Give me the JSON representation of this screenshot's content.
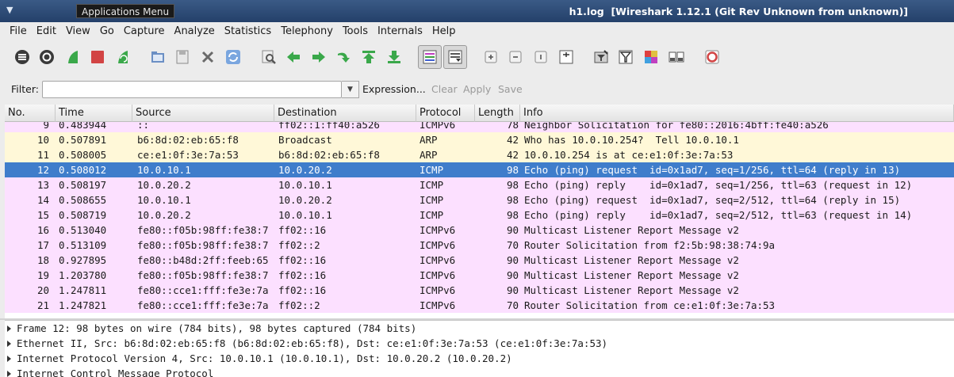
{
  "titlebar": {
    "app_menu": "Applications Menu",
    "title": "h1.log  [Wireshark 1.12.1 (Git Rev Unknown from unknown)]"
  },
  "menubar": [
    "File",
    "Edit",
    "View",
    "Go",
    "Capture",
    "Analyze",
    "Statistics",
    "Telephony",
    "Tools",
    "Internals",
    "Help"
  ],
  "toolbar": {
    "icons": [
      "interface-list-icon",
      "capture-options-icon",
      "start-capture-icon",
      "stop-capture-icon",
      "restart-capture-icon",
      "open-file-icon",
      "save-file-icon",
      "close-file-icon",
      "reload-icon",
      "find-packet-icon",
      "go-back-icon",
      "go-forward-icon",
      "go-to-packet-icon",
      "go-first-icon",
      "go-last-icon",
      "colorize-icon",
      "auto-scroll-icon",
      "zoom-in-icon",
      "zoom-out-icon",
      "normal-size-icon",
      "resize-columns-icon",
      "capture-filters-icon",
      "display-filters-icon",
      "coloring-rules-icon",
      "preferences-icon",
      "help-icon"
    ],
    "accent_green": "#3aa84a",
    "accent_red": "#d24444"
  },
  "filterbar": {
    "label": "Filter:",
    "value": "",
    "expression": "Expression...",
    "clear": "Clear",
    "apply": "Apply",
    "save": "Save"
  },
  "columns": [
    "No.",
    "Time",
    "Source",
    "Destination",
    "Protocol",
    "Length",
    "Info"
  ],
  "colors": {
    "icmpv6_bg": "#fce0ff",
    "arp_bg": "#fff8d8",
    "icmp_bg": "#fce0ff",
    "selected_bg": "#3f7dcb"
  },
  "packets": [
    {
      "no": "9",
      "time": "0.483944",
      "src": "::",
      "dst": "ff02::1:ff40:a526",
      "proto": "ICMPv6",
      "len": "78",
      "info": "Neighbor Solicitation for fe80::2016:4bff:fe40:a526",
      "kind": "icmpv6",
      "selected": false
    },
    {
      "no": "10",
      "time": "0.507891",
      "src": "b6:8d:02:eb:65:f8",
      "dst": "Broadcast",
      "proto": "ARP",
      "len": "42",
      "info": "Who has 10.0.10.254?  Tell 10.0.10.1",
      "kind": "arp",
      "selected": false
    },
    {
      "no": "11",
      "time": "0.508005",
      "src": "ce:e1:0f:3e:7a:53",
      "dst": "b6:8d:02:eb:65:f8",
      "proto": "ARP",
      "len": "42",
      "info": "10.0.10.254 is at ce:e1:0f:3e:7a:53",
      "kind": "arp",
      "selected": false
    },
    {
      "no": "12",
      "time": "0.508012",
      "src": "10.0.10.1",
      "dst": "10.0.20.2",
      "proto": "ICMP",
      "len": "98",
      "info": "Echo (ping) request  id=0x1ad7, seq=1/256, ttl=64 (reply in 13)",
      "kind": "icmp",
      "selected": true
    },
    {
      "no": "13",
      "time": "0.508197",
      "src": "10.0.20.2",
      "dst": "10.0.10.1",
      "proto": "ICMP",
      "len": "98",
      "info": "Echo (ping) reply    id=0x1ad7, seq=1/256, ttl=63 (request in 12)",
      "kind": "icmp",
      "selected": false
    },
    {
      "no": "14",
      "time": "0.508655",
      "src": "10.0.10.1",
      "dst": "10.0.20.2",
      "proto": "ICMP",
      "len": "98",
      "info": "Echo (ping) request  id=0x1ad7, seq=2/512, ttl=64 (reply in 15)",
      "kind": "icmp",
      "selected": false
    },
    {
      "no": "15",
      "time": "0.508719",
      "src": "10.0.20.2",
      "dst": "10.0.10.1",
      "proto": "ICMP",
      "len": "98",
      "info": "Echo (ping) reply    id=0x1ad7, seq=2/512, ttl=63 (request in 14)",
      "kind": "icmp",
      "selected": false
    },
    {
      "no": "16",
      "time": "0.513040",
      "src": "fe80::f05b:98ff:fe38:7",
      "dst": "ff02::16",
      "proto": "ICMPv6",
      "len": "90",
      "info": "Multicast Listener Report Message v2",
      "kind": "icmpv6",
      "selected": false
    },
    {
      "no": "17",
      "time": "0.513109",
      "src": "fe80::f05b:98ff:fe38:7",
      "dst": "ff02::2",
      "proto": "ICMPv6",
      "len": "70",
      "info": "Router Solicitation from f2:5b:98:38:74:9a",
      "kind": "icmpv6",
      "selected": false
    },
    {
      "no": "18",
      "time": "0.927895",
      "src": "fe80::b48d:2ff:feeb:65",
      "dst": "ff02::16",
      "proto": "ICMPv6",
      "len": "90",
      "info": "Multicast Listener Report Message v2",
      "kind": "icmpv6",
      "selected": false
    },
    {
      "no": "19",
      "time": "1.203780",
      "src": "fe80::f05b:98ff:fe38:7",
      "dst": "ff02::16",
      "proto": "ICMPv6",
      "len": "90",
      "info": "Multicast Listener Report Message v2",
      "kind": "icmpv6",
      "selected": false
    },
    {
      "no": "20",
      "time": "1.247811",
      "src": "fe80::cce1:fff:fe3e:7a",
      "dst": "ff02::16",
      "proto": "ICMPv6",
      "len": "90",
      "info": "Multicast Listener Report Message v2",
      "kind": "icmpv6",
      "selected": false
    },
    {
      "no": "21",
      "time": "1.247821",
      "src": "fe80::cce1:fff:fe3e:7a",
      "dst": "ff02::2",
      "proto": "ICMPv6",
      "len": "70",
      "info": "Router Solicitation from ce:e1:0f:3e:7a:53",
      "kind": "icmpv6",
      "selected": false
    }
  ],
  "details": [
    "Frame 12: 98 bytes on wire (784 bits), 98 bytes captured (784 bits)",
    "Ethernet II, Src: b6:8d:02:eb:65:f8 (b6:8d:02:eb:65:f8), Dst: ce:e1:0f:3e:7a:53 (ce:e1:0f:3e:7a:53)",
    "Internet Protocol Version 4, Src: 10.0.10.1 (10.0.10.1), Dst: 10.0.20.2 (10.0.20.2)",
    "Internet Control Message Protocol"
  ]
}
